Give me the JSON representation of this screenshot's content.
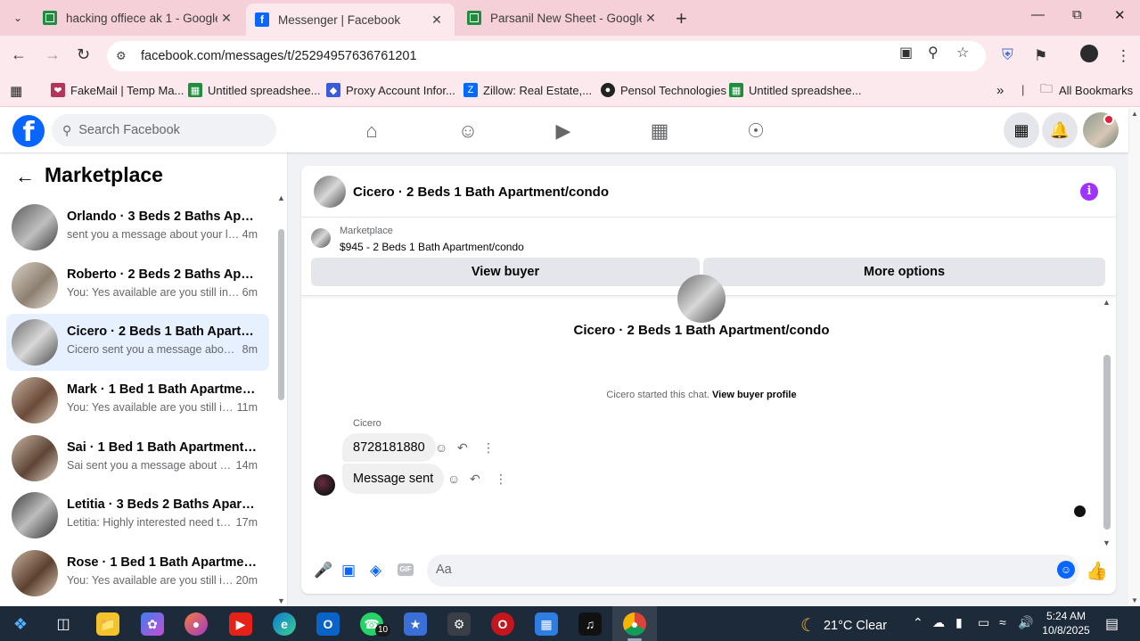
{
  "browser": {
    "tabs": [
      {
        "title": "hacking offiece ak 1 - Google Sh",
        "icon": "sheets-icon",
        "active": false
      },
      {
        "title": "Messenger | Facebook",
        "icon": "facebook-icon",
        "active": true
      },
      {
        "title": "Parsanil New Sheet - Google Sh",
        "icon": "sheets-icon",
        "active": false
      }
    ],
    "url": "facebook.com/messages/t/25294957636761201",
    "bookmarks": [
      {
        "label": "FakeMail | Temp Ma...",
        "icon": "fakemail-icon",
        "color": "#b5345b"
      },
      {
        "label": "Untitled spreadshee...",
        "icon": "sheets-icon",
        "color": "#1e8e3e"
      },
      {
        "label": "Proxy Account Infor...",
        "icon": "proxy-icon",
        "color": "#3b5bdb"
      },
      {
        "label": "Zillow: Real Estate,...",
        "icon": "zillow-icon",
        "color": "#006aff"
      },
      {
        "label": "Pensol Technologies",
        "icon": "pensol-icon",
        "color": "#222222"
      },
      {
        "label": "Untitled spreadshee...",
        "icon": "sheets-icon",
        "color": "#1e8e3e"
      }
    ],
    "all_bookmarks": "All Bookmarks"
  },
  "facebook": {
    "logo": "f",
    "search_placeholder": "Search Facebook",
    "accent": "#0866ff"
  },
  "sidebar": {
    "title": "Marketplace",
    "conversations": [
      {
        "name": "Orlando · 3 Beds 2 Baths Apart...",
        "preview": "sent you a message about your list...",
        "time": "4m",
        "selected": false
      },
      {
        "name": "Roberto · 2 Beds 2 Baths Apart...",
        "preview": "You: Yes available are you still inter...",
        "time": "6m",
        "selected": false
      },
      {
        "name": "Cicero · 2 Beds 1 Bath Apartmen...",
        "preview": "Cicero sent you a message about ...",
        "time": "8m",
        "selected": true
      },
      {
        "name": "Mark · 1 Bed 1 Bath Apartment/...",
        "preview": "You: Yes available are you still int...",
        "time": "11m",
        "selected": false
      },
      {
        "name": "Sai · 1 Bed 1 Bath Apartment/co...",
        "preview": "Sai sent you a message about yo...",
        "time": "14m",
        "selected": false
      },
      {
        "name": "Letitia · 3 Beds 2 Baths Apartme...",
        "preview": "Letitia: Highly interested need to ...",
        "time": "17m",
        "selected": false
      },
      {
        "name": "Rose · 1 Bed 1 Bath Apartment/c...",
        "preview": "You: Yes available are you still int...",
        "time": "20m",
        "selected": false
      }
    ]
  },
  "chat": {
    "title": "Cicero · 2 Beds 1 Bath Apartment/condo",
    "marketplace_label": "Marketplace",
    "listing": "$945 - 2 Beds 1 Bath Apartment/condo",
    "view_buyer": "View buyer",
    "more_options": "More options",
    "conversation_title": "Cicero · 2 Beds 1 Bath Apartment/condo",
    "started_text": "Cicero started this chat.",
    "view_buyer_profile": "View buyer profile",
    "sender": "Cicero",
    "messages": [
      {
        "text": "8728181880"
      },
      {
        "text": "Message sent"
      }
    ],
    "composer_placeholder": "Aa"
  },
  "taskbar": {
    "whatsapp_badge": "10",
    "temperature": "21°C",
    "weather": "Clear",
    "time": "5:24 AM",
    "date": "10/8/2025"
  }
}
